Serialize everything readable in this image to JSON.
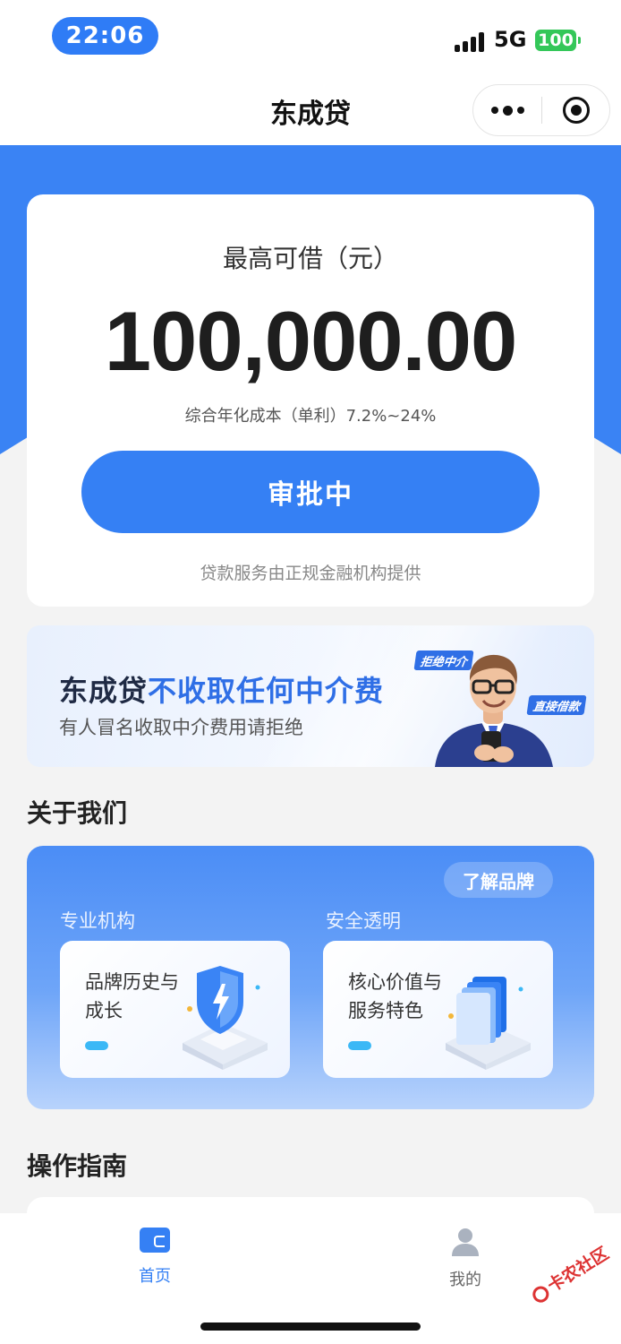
{
  "status_bar": {
    "time": "22:06",
    "network": "5G",
    "battery": "100"
  },
  "nav": {
    "title": "东成贷"
  },
  "loan_card": {
    "max_label": "最高可借（元）",
    "amount": "100,000.00",
    "rate_text": "综合年化成本（单利）7.2%~24%",
    "button_label": "审批中",
    "provider_text": "贷款服务由正规金融机构提供"
  },
  "banner": {
    "brand": "东成贷",
    "highlight": "不收取任何中介费",
    "subtitle": "有人冒名收取中介费用请拒绝",
    "tag_reject": "拒绝中介",
    "tag_direct": "直接借款"
  },
  "about": {
    "title": "关于我们",
    "brand_button": "了解品牌",
    "cards": [
      {
        "label": "专业机构",
        "text_line1": "品牌历史与",
        "text_line2": "成长"
      },
      {
        "label": "安全透明",
        "text_line1": "核心价值与",
        "text_line2": "服务特色"
      }
    ]
  },
  "guide": {
    "title": "操作指南"
  },
  "tab_bar": {
    "tabs": [
      {
        "label": "首页",
        "icon": "wallet-icon"
      },
      {
        "label": "我的",
        "icon": "user-icon"
      }
    ]
  },
  "watermark": {
    "text": "卡农社区"
  },
  "colors": {
    "primary": "#3580f4",
    "highlight": "#2f6fe6",
    "background": "#f3f3f3",
    "battery": "#34c759"
  }
}
